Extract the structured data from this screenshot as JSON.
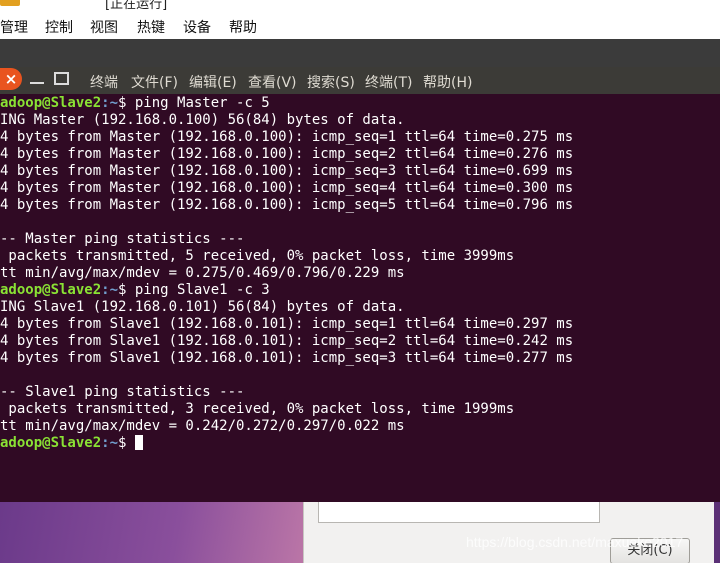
{
  "host": {
    "title": "[正在运行]",
    "menu": [
      "管理",
      "控制",
      "视图",
      "热键",
      "设备",
      "帮助"
    ]
  },
  "terminal": {
    "close_glyph": "×",
    "menu": [
      "终端",
      "文件(F)",
      "编辑(E)",
      "查看(V)",
      "搜索(S)",
      "终端(T)",
      "帮助(H)"
    ],
    "lines": [
      {
        "user": "adoop@Slave2",
        "path": ":~",
        "cmd": "$ ping Master -c 5"
      },
      {
        "text": "ING Master (192.168.0.100) 56(84) bytes of data."
      },
      {
        "text": "4 bytes from Master (192.168.0.100): icmp_seq=1 ttl=64 time=0.275 ms"
      },
      {
        "text": "4 bytes from Master (192.168.0.100): icmp_seq=2 ttl=64 time=0.276 ms"
      },
      {
        "text": "4 bytes from Master (192.168.0.100): icmp_seq=3 ttl=64 time=0.699 ms"
      },
      {
        "text": "4 bytes from Master (192.168.0.100): icmp_seq=4 ttl=64 time=0.300 ms"
      },
      {
        "text": "4 bytes from Master (192.168.0.100): icmp_seq=5 ttl=64 time=0.796 ms"
      },
      {
        "text": ""
      },
      {
        "text": "-- Master ping statistics ---"
      },
      {
        "text": " packets transmitted, 5 received, 0% packet loss, time 3999ms"
      },
      {
        "text": "tt min/avg/max/mdev = 0.275/0.469/0.796/0.229 ms"
      },
      {
        "user": "adoop@Slave2",
        "path": ":~",
        "cmd": "$ ping Slave1 -c 3"
      },
      {
        "text": "ING Slave1 (192.168.0.101) 56(84) bytes of data."
      },
      {
        "text": "4 bytes from Slave1 (192.168.0.101): icmp_seq=1 ttl=64 time=0.297 ms"
      },
      {
        "text": "4 bytes from Slave1 (192.168.0.101): icmp_seq=2 ttl=64 time=0.242 ms"
      },
      {
        "text": "4 bytes from Slave1 (192.168.0.101): icmp_seq=3 ttl=64 time=0.277 ms"
      },
      {
        "text": ""
      },
      {
        "text": "-- Slave1 ping statistics ---"
      },
      {
        "text": " packets transmitted, 3 received, 0% packet loss, time 1999ms"
      },
      {
        "text": "tt min/avg/max/mdev = 0.242/0.272/0.297/0.022 ms"
      },
      {
        "user": "adoop@Slave2",
        "path": ":~",
        "cmd": "$ ",
        "cursor": true
      }
    ]
  },
  "dialog": {
    "close_button": "关闭(C)"
  },
  "watermark": "https://blog.csdn.net/maxueke2017",
  "colors": {
    "terminal_bg": "#300a24",
    "prompt_user": "#8ae234",
    "prompt_path": "#729fcf",
    "close_button": "#e9541f"
  }
}
